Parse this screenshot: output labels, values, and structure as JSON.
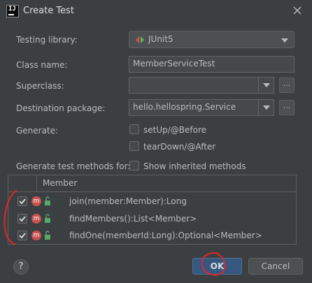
{
  "window": {
    "title": "Create Test",
    "app_icon": "IJ"
  },
  "form": {
    "testing_library_label": "Testing library:",
    "testing_library_value": "JUnit5",
    "class_name_label": "Class name:",
    "class_name_value": "MemberServiceTest",
    "superclass_label": "Superclass:",
    "superclass_value": "",
    "destination_package_label": "Destination package:",
    "destination_package_value": "hello.hellospring.Service",
    "browse_label": "...",
    "generate_label": "Generate:",
    "setup_label": "setUp/@Before",
    "teardown_label": "tearDown/@After",
    "methods_for_label": "Generate test methods for:",
    "show_inherited_label": "Show inherited methods"
  },
  "methods_table": {
    "column_header": "Member",
    "rows": [
      {
        "checked": true,
        "icon": "m",
        "signature": "join(member:Member):Long"
      },
      {
        "checked": true,
        "icon": "m",
        "signature": "findMembers():List<Member>"
      },
      {
        "checked": true,
        "icon": "m",
        "signature": "findOne(memberId:Long):Optional<Member>"
      }
    ]
  },
  "footer": {
    "help_label": "?",
    "ok_label": "OK",
    "cancel_label": "Cancel"
  },
  "colors": {
    "background": "#3c3f41",
    "accent": "#365880",
    "method_icon": "#c75450",
    "annotation": "#e0262b"
  }
}
